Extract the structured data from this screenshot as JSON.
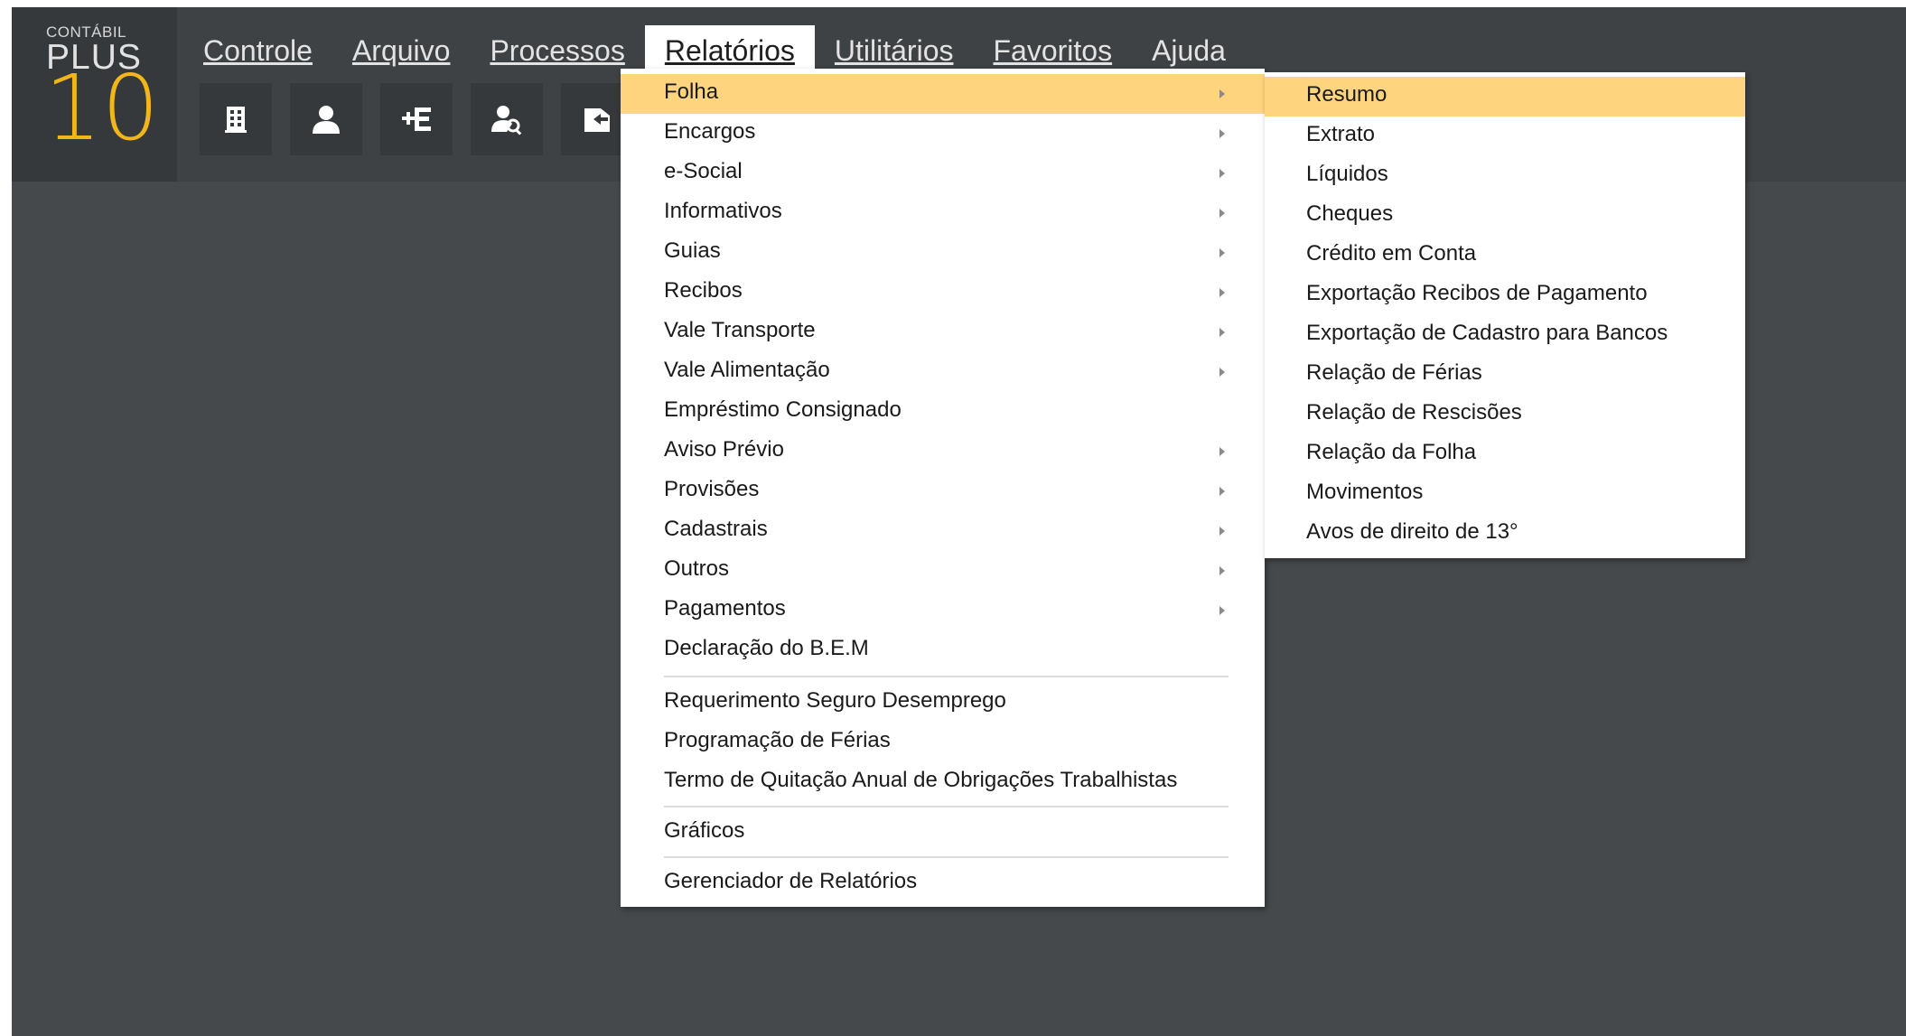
{
  "logo": {
    "small": "CONTÁBIL",
    "plus": "PLUS",
    "num": "10",
    "accent": "#f3b61a"
  },
  "menubar": [
    {
      "label": "Controle",
      "active": false
    },
    {
      "label": "Arquivo",
      "active": false
    },
    {
      "label": "Processos",
      "active": false
    },
    {
      "label": "Relatórios",
      "active": true
    },
    {
      "label": "Utilitários",
      "active": false
    },
    {
      "label": "Favoritos",
      "active": false
    },
    {
      "label": "Ajuda",
      "active": false
    }
  ],
  "toolbar": [
    "building-icon",
    "user-icon",
    "add-e-icon",
    "user-search-icon",
    "exit-icon"
  ],
  "relatorios_menu": [
    {
      "label": "Folha",
      "submenu": true,
      "highlighted": true
    },
    {
      "label": "Encargos",
      "submenu": true
    },
    {
      "label": "e-Social",
      "submenu": true
    },
    {
      "label": "Informativos",
      "submenu": true
    },
    {
      "label": "Guias",
      "submenu": true
    },
    {
      "label": "Recibos",
      "submenu": true
    },
    {
      "label": "Vale Transporte",
      "submenu": true
    },
    {
      "label": "Vale Alimentação",
      "submenu": true
    },
    {
      "label": "Empréstimo Consignado",
      "submenu": false
    },
    {
      "label": "Aviso Prévio",
      "submenu": true
    },
    {
      "label": "Provisões",
      "submenu": true
    },
    {
      "label": "Cadastrais",
      "submenu": true
    },
    {
      "label": "Outros",
      "submenu": true
    },
    {
      "label": "Pagamentos",
      "submenu": true
    },
    {
      "label": "Declaração do B.E.M",
      "submenu": false
    },
    {
      "label": "Requerimento Seguro Desemprego",
      "submenu": false
    },
    {
      "label": "Programação de Férias",
      "submenu": false
    },
    {
      "label": "Termo de Quitação Anual de Obrigações Trabalhistas",
      "submenu": false
    },
    {
      "label": "Gráficos",
      "submenu": false
    },
    {
      "label": "Gerenciador de Relatórios",
      "submenu": false
    }
  ],
  "folha_submenu": [
    {
      "label": "Resumo",
      "highlighted": true
    },
    {
      "label": "Extrato"
    },
    {
      "label": "Líquidos"
    },
    {
      "label": "Cheques"
    },
    {
      "label": "Crédito em Conta"
    },
    {
      "label": "Exportação Recibos de Pagamento"
    },
    {
      "label": "Exportação de Cadastro para Bancos"
    },
    {
      "label": "Relação de Férias"
    },
    {
      "label": "Relação de Rescisões"
    },
    {
      "label": "Relação da Folha"
    },
    {
      "label": "Movimentos"
    },
    {
      "label": "Avos de direito de 13°"
    }
  ]
}
